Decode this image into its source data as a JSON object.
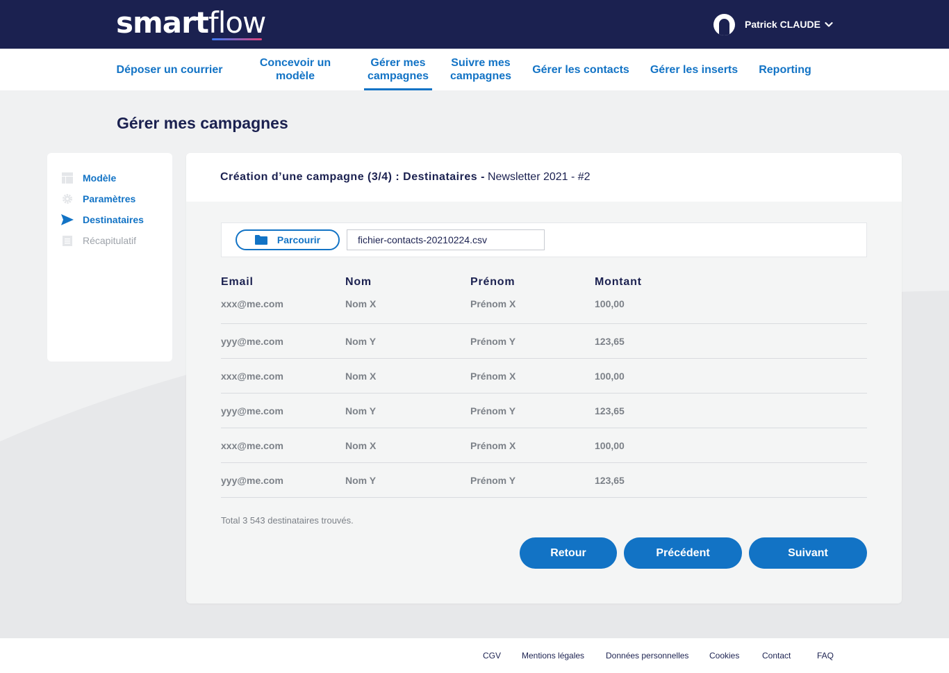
{
  "brand": {
    "logo_bold": "smart",
    "logo_light": "flow"
  },
  "user": {
    "name": "Patrick CLAUDE"
  },
  "nav": {
    "items": [
      {
        "label": "Déposer un courrier"
      },
      {
        "label": "Concevoir un modèle"
      },
      {
        "label": "Gérer mes campagnes"
      },
      {
        "label": "Suivre mes campagnes"
      },
      {
        "label": "Gérer les contacts"
      },
      {
        "label": "Gérer les inserts"
      },
      {
        "label": "Reporting"
      }
    ],
    "active_index": 2
  },
  "page_title": "Gérer mes campagnes",
  "steps": [
    {
      "label": "Modèle",
      "icon": "layout-icon",
      "state": "done"
    },
    {
      "label": "Paramètres",
      "icon": "gear-icon",
      "state": "done"
    },
    {
      "label": "Destinataires",
      "icon": "send-icon",
      "state": "current"
    },
    {
      "label": "Récapitulatif",
      "icon": "document-icon",
      "state": "disabled"
    }
  ],
  "card": {
    "title": "Création d’une campagne (3/4) : Destinataires",
    "separator": "-",
    "subtitle": "Newsletter 2021 - #2"
  },
  "upload": {
    "browse_label": "Parcourir",
    "file_name": "fichier-contacts-20210224.csv"
  },
  "table": {
    "headers": [
      "Email",
      "Nom",
      "Prénom",
      "Montant"
    ],
    "rows": [
      [
        "xxx@me.com",
        "Nom X",
        "Prénom X",
        "100,00"
      ],
      [
        "yyy@me.com",
        "Nom Y",
        "Prénom Y",
        "123,65"
      ],
      [
        "xxx@me.com",
        "Nom X",
        "Prénom X",
        "100,00"
      ],
      [
        "yyy@me.com",
        "Nom Y",
        "Prénom Y",
        "123,65"
      ],
      [
        "xxx@me.com",
        "Nom X",
        "Prénom X",
        "100,00"
      ],
      [
        "yyy@me.com",
        "Nom Y",
        "Prénom Y",
        "123,65"
      ]
    ]
  },
  "total_text": "Total 3 543 destinataires trouvés.",
  "actions": {
    "back": "Retour",
    "previous": "Précédent",
    "next": "Suivant"
  },
  "footer": {
    "links": [
      "CGV",
      "Mentions légales",
      "Données personnelles",
      "Cookies",
      "Contact",
      "FAQ"
    ]
  },
  "colors": {
    "navy": "#1b2150",
    "primary": "#1273c5",
    "muted": "#7c8188",
    "background": "#f0f1f2"
  }
}
